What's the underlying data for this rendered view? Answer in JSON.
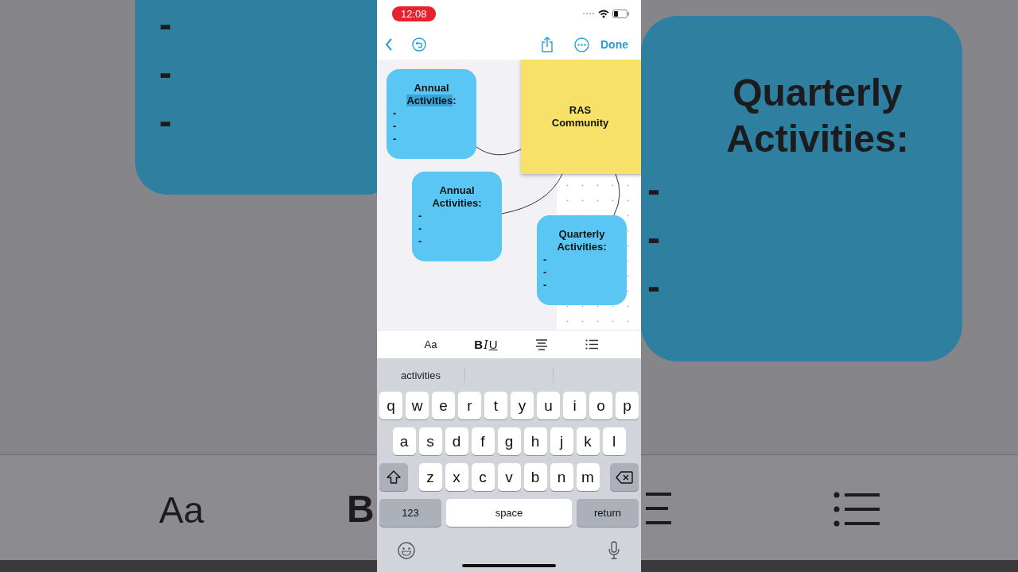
{
  "status_bar": {
    "time": "12:08"
  },
  "nav_bar": {
    "done": "Done"
  },
  "canvas": {
    "sticky": {
      "lines": [
        "RAS",
        "Community"
      ]
    },
    "notes": [
      {
        "title_lines": [
          {
            "text": "Annual",
            "highlighted": false
          },
          {
            "text": "Activities",
            "highlighted": true
          },
          {
            "text": ":",
            "highlighted": false
          }
        ],
        "lines": [
          "-",
          "-",
          "-"
        ]
      },
      {
        "title_lines": [
          {
            "text": "Annual",
            "highlighted": false
          },
          {
            "text": "Activities:",
            "highlighted": false
          }
        ],
        "lines": [
          "-",
          "-",
          "-"
        ]
      },
      {
        "title_lines": [
          {
            "text": "Quarterly",
            "highlighted": false
          },
          {
            "text": "Activities:",
            "highlighted": false
          }
        ],
        "lines": [
          "-",
          "-",
          "-"
        ]
      }
    ]
  },
  "format_bar": {
    "font": "Aa",
    "bold": "B",
    "italic": "I",
    "underline": "U"
  },
  "keyboard": {
    "suggestions": [
      "activities"
    ],
    "rows": [
      [
        "q",
        "w",
        "e",
        "r",
        "t",
        "y",
        "u",
        "i",
        "o",
        "p"
      ],
      [
        "a",
        "s",
        "d",
        "f",
        "g",
        "h",
        "j",
        "k",
        "l"
      ],
      [
        "z",
        "x",
        "c",
        "v",
        "b",
        "n",
        "m"
      ]
    ],
    "numbers": "123",
    "space": "space",
    "return": "return"
  },
  "backdrop_left": {
    "note_lines": [
      "-",
      "-",
      "-"
    ],
    "font_label": "Aa",
    "bold_label": "B"
  },
  "backdrop_right": {
    "note_title": [
      "Quarterly",
      "Activities:"
    ],
    "note_lines": [
      "-",
      "-",
      "-"
    ]
  }
}
